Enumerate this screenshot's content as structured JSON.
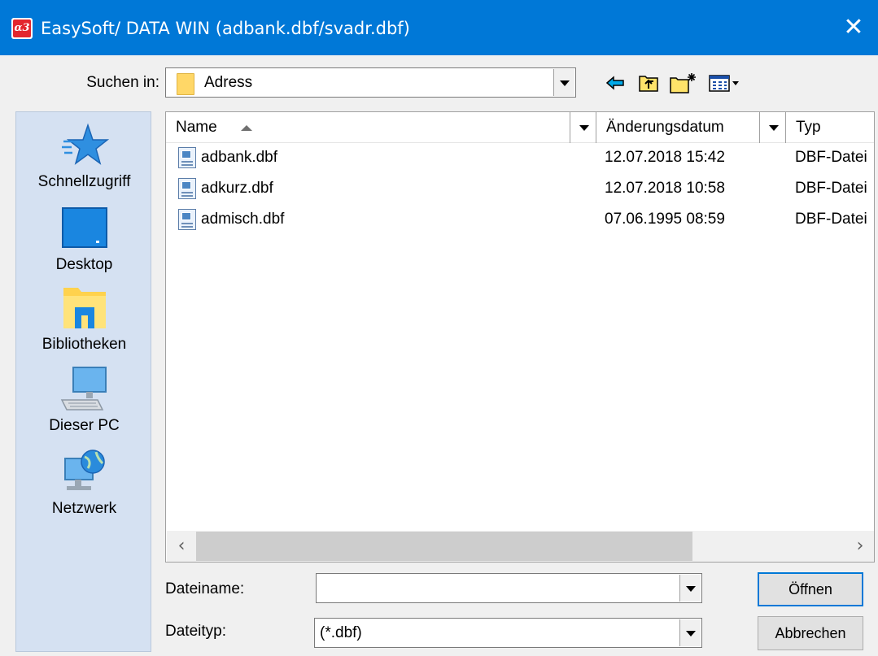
{
  "window": {
    "app_icon_text": "α3",
    "title": "EasySoft/ DATA WIN (adbank.dbf/svadr.dbf)",
    "close_glyph": "✕",
    "accent_color": "#0078d7"
  },
  "lookin": {
    "label": "Suchen in:",
    "value": "Adress",
    "icon": "folder-icon"
  },
  "toolbar": {
    "items": [
      "back-icon",
      "up-folder-icon",
      "new-folder-icon",
      "view-menu-icon"
    ]
  },
  "places": [
    {
      "label": "Schnellzugriff",
      "icon": "star-icon"
    },
    {
      "label": "Desktop",
      "icon": "desktop-icon"
    },
    {
      "label": "Bibliotheken",
      "icon": "library-icon"
    },
    {
      "label": "Dieser PC",
      "icon": "computer-icon"
    },
    {
      "label": "Netzwerk",
      "icon": "network-icon"
    }
  ],
  "columns": {
    "name": "Name",
    "date": "Änderungsdatum",
    "type": "Typ"
  },
  "files": [
    {
      "name": "adbank.dbf",
      "date": "12.07.2018 15:42",
      "type": "DBF-Datei"
    },
    {
      "name": "adkurz.dbf",
      "date": "12.07.2018 10:58",
      "type": "DBF-Datei"
    },
    {
      "name": "admisch.dbf",
      "date": "07.06.1995 08:59",
      "type": "DBF-Datei"
    }
  ],
  "scrollbar": {
    "left_glyph": "‹",
    "right_glyph": "›"
  },
  "filename": {
    "label": "Dateiname:",
    "value": ""
  },
  "filetype": {
    "label": "Dateityp:",
    "value": "(*.dbf)"
  },
  "buttons": {
    "open": "Öffnen",
    "cancel": "Abbrechen"
  }
}
